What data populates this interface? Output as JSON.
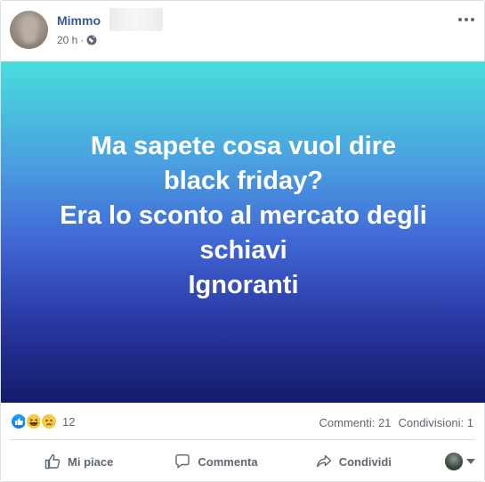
{
  "post": {
    "author": "Mimmo",
    "time": "20 h",
    "separator": "·",
    "image_text_lines": [
      "Ma sapete cosa vuol dire",
      "black friday?",
      "Era lo sconto al mercato degli",
      "schiavi",
      "Ignoranti"
    ]
  },
  "reactions": {
    "icons": [
      "like-icon",
      "haha-icon",
      "sad-icon"
    ],
    "count": "12",
    "comments": "Commenti: 21",
    "shares": "Condivisioni: 1"
  },
  "actions": {
    "like": "Mi piace",
    "comment": "Commenta",
    "share": "Condividi"
  },
  "colors": {
    "author_link": "#385898",
    "gradient_top": "#47dedb",
    "gradient_bottom": "#121b6a",
    "secondary_text": "#606770"
  }
}
